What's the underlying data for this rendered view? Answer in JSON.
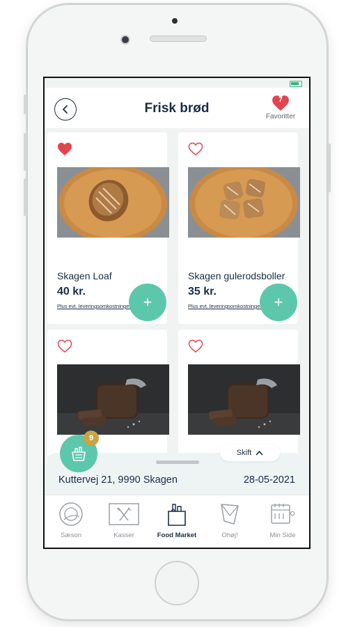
{
  "header": {
    "title": "Frisk brød",
    "favorites_count": "7",
    "favorites_label": "Favoritter"
  },
  "products": [
    {
      "name": "Skagen Loaf",
      "price": "40 kr.",
      "note": "Plus evt. leveringsomkostninger",
      "favorited": true,
      "add_label": "+"
    },
    {
      "name": "Skagen gulerodsboller",
      "price": "35 kr.",
      "note": "Plus evt. leveringsomkostninger",
      "favorited": false,
      "add_label": "+"
    },
    {
      "favorited": false
    },
    {
      "favorited": false
    }
  ],
  "basket": {
    "count": "9"
  },
  "delivery": {
    "switch_label": "Skift",
    "address": "Kuttervej 21, 9990 Skagen",
    "date": "28-05-2021"
  },
  "tabs": [
    {
      "label": "Sæson",
      "icon": "plate-icon",
      "active": false
    },
    {
      "label": "Kasser",
      "icon": "cutlery-icon",
      "active": false
    },
    {
      "label": "Food Market",
      "icon": "grocery-bag-icon",
      "active": true
    },
    {
      "label": "Ohøj!",
      "icon": "napkin-icon",
      "active": false
    },
    {
      "label": "Min Side",
      "icon": "calendar-icon",
      "active": false
    }
  ],
  "colors": {
    "accent": "#5cc7ab",
    "heart": "#e2454f",
    "badge": "#c9a347",
    "text": "#1a2d45"
  }
}
